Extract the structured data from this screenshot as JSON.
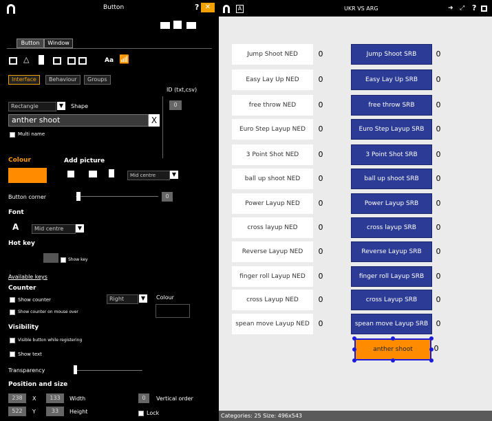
{
  "left_panel": {
    "title": "Button",
    "tabs_top": [
      "Button",
      "Window"
    ],
    "tabs": [
      "Interface",
      "Behaviour",
      "Groups"
    ],
    "id_label": "ID (txt,csv)",
    "id_value": "0",
    "shape_select": "Rectangle",
    "shape_label": "Shape",
    "name_value": "anther shoot",
    "clear_label": "X",
    "multi_lang_label": "Multi name",
    "colour_label": "Colour",
    "colour_value": "#ff8c00",
    "add_picture_label": "Add picture",
    "picture_pos_select": "Mid centre",
    "button_corner_label": "Button corner",
    "button_corner_value": "0",
    "font_label": "Font",
    "font_align_select": "Mid centre",
    "hot_key_label": "Hot key",
    "show_key_label": "Show key",
    "available_keys_label": "Available keys",
    "counter_label": "Counter",
    "show_counter_label": "Show counter",
    "counter_pos_select": "Right",
    "counter_colour_label": "Colour",
    "show_counter_mouse_label": "Show counter on mouse over",
    "visibility_label": "Visibility",
    "visible_button_label": "Visible button while registering",
    "show_text_label": "Show text",
    "transparency_label": "Transparency",
    "pos_size_label": "Position and size",
    "x_value": "238",
    "x_label": "X",
    "width_value": "133",
    "width_label": "Width",
    "y_value": "522",
    "y_label": "Y",
    "height_value": "33",
    "height_label": "Height",
    "vertical_order_value": "0",
    "vertical_order_label": "Vertical order",
    "lock_label": "Lock",
    "status_text": "Categories: 25 Size: 496x543"
  },
  "right_panel": {
    "title": "UKR VS ARG",
    "ned_buttons": [
      "Jump Shoot NED",
      "Easy Lay Up NED",
      "free throw NED",
      "Euro Step Layup NED",
      "3 Point Shot NED",
      "ball up shoot NED",
      "Power Layup NED",
      "cross layup NED",
      "Reverse Layup NED",
      "finger roll  Layup NED",
      "cross Layup NED",
      "spean move Layup NED"
    ],
    "ned_counts": [
      "0",
      "0",
      "0",
      "0",
      "0",
      "0",
      "0",
      "0",
      "0",
      "0",
      "0",
      "0"
    ],
    "srb_buttons": [
      "Jump Shoot SRB",
      "Easy Lay Up SRB",
      "free throw SRB",
      "Euro Step Layup SRB",
      "3 Point Shot SRB",
      "ball up shoot SRB",
      "Power Layup SRB",
      "cross layup SRB",
      "Reverse Layup SRB",
      "finger roll  Layup SRB",
      "cross Layup SRB",
      "spean move Layup SRB"
    ],
    "srb_counts": [
      "0",
      "0",
      "0",
      "0",
      "0",
      "0",
      "0",
      "0",
      "0",
      "0",
      "0",
      "0"
    ],
    "selected_button": "anther shoot",
    "selected_count": "0",
    "colors": {
      "ned_bg": "#ffffff",
      "srb_bg": "#2c3b95",
      "selected_bg": "#ff8c00",
      "handle": "#1a1adb"
    }
  }
}
